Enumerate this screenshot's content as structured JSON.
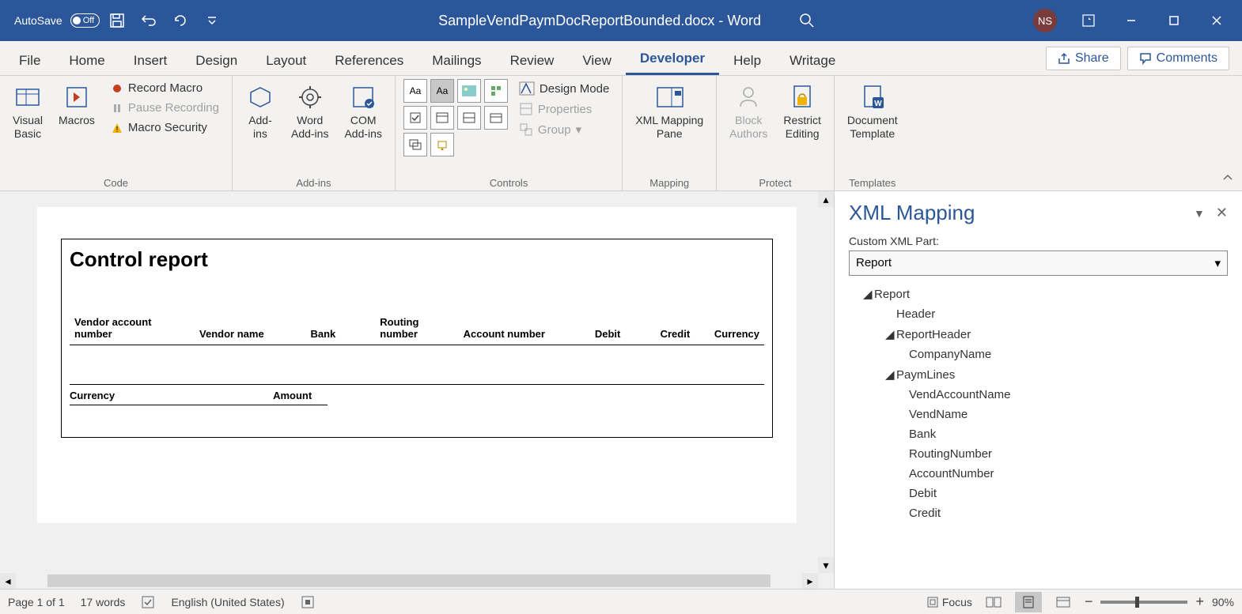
{
  "titlebar": {
    "autosave_label": "AutoSave",
    "autosave_state": "Off",
    "title": "SampleVendPaymDocReportBounded.docx - Word",
    "avatar": "NS"
  },
  "tabs": [
    "File",
    "Home",
    "Insert",
    "Design",
    "Layout",
    "References",
    "Mailings",
    "Review",
    "View",
    "Developer",
    "Help",
    "Writage"
  ],
  "active_tab": "Developer",
  "share_btn": "Share",
  "comments_btn": "Comments",
  "ribbon": {
    "code": {
      "visual_basic": "Visual\nBasic",
      "macros": "Macros",
      "record": "Record Macro",
      "pause": "Pause Recording",
      "security": "Macro Security",
      "group_label": "Code"
    },
    "addins": {
      "addins": "Add-\nins",
      "word_addins": "Word\nAdd-ins",
      "com_addins": "COM\nAdd-ins",
      "group_label": "Add-ins"
    },
    "controls": {
      "design_mode": "Design Mode",
      "properties": "Properties",
      "group": "Group",
      "group_label": "Controls"
    },
    "mapping": {
      "xml_mapping": "XML Mapping\nPane",
      "group_label": "Mapping"
    },
    "protect": {
      "block_authors": "Block\nAuthors",
      "restrict": "Restrict\nEditing",
      "group_label": "Protect"
    },
    "templates": {
      "doc_template": "Document\nTemplate",
      "group_label": "Templates"
    }
  },
  "document": {
    "title": "Control report",
    "headers": [
      "Vendor account number",
      "Vendor name",
      "Bank",
      "Routing number",
      "Account number",
      "Debit",
      "Credit",
      "Currency"
    ],
    "summary_headers": [
      "Currency",
      "Amount"
    ]
  },
  "sidepane": {
    "title": "XML Mapping",
    "label": "Custom XML Part:",
    "selected": "Report",
    "tree": {
      "root": "Report",
      "header": "Header",
      "report_header": "ReportHeader",
      "company_name": "CompanyName",
      "paym_lines": "PaymLines",
      "fields": [
        "VendAccountName",
        "VendName",
        "Bank",
        "RoutingNumber",
        "AccountNumber",
        "Debit",
        "Credit"
      ]
    }
  },
  "status": {
    "page": "Page 1 of 1",
    "words": "17 words",
    "lang": "English (United States)",
    "focus": "Focus",
    "zoom": "90%"
  }
}
